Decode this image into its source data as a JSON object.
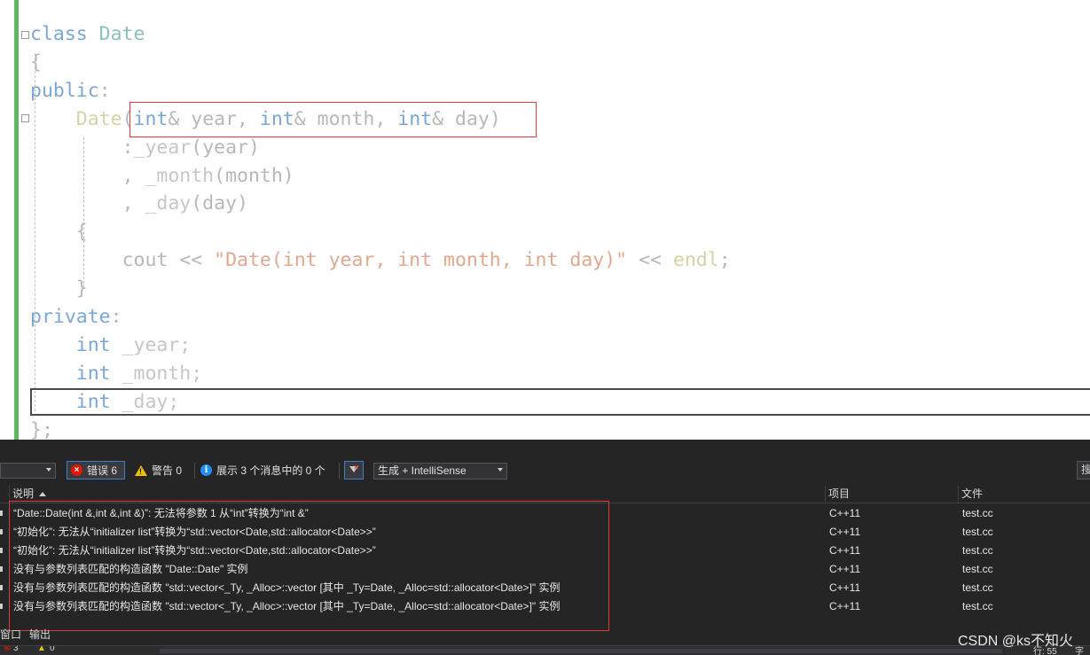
{
  "code": {
    "lines": [
      {
        "segments": [
          {
            "t": "class ",
            "c": "kw"
          },
          {
            "t": "Date",
            "c": "typ"
          }
        ]
      },
      {
        "segments": [
          {
            "t": "{",
            "c": "plain"
          }
        ]
      },
      {
        "segments": [
          {
            "t": "public",
            "c": "kw"
          },
          {
            "t": ":",
            "c": "plain"
          }
        ]
      },
      {
        "segments": [
          {
            "t": "    "
          },
          {
            "t": "Date",
            "c": "fn"
          },
          {
            "t": "(",
            "c": "plain"
          },
          {
            "t": "int",
            "c": "kw"
          },
          {
            "t": "& year, ",
            "c": "plain"
          },
          {
            "t": "int",
            "c": "kw"
          },
          {
            "t": "& month, ",
            "c": "plain"
          },
          {
            "t": "int",
            "c": "kw"
          },
          {
            "t": "& day)",
            "c": "plain"
          }
        ]
      },
      {
        "segments": [
          {
            "t": "        "
          },
          {
            "t": ":",
            "c": "plain"
          },
          {
            "t": "_year",
            "c": "mem"
          },
          {
            "t": "(year)",
            "c": "plain"
          }
        ]
      },
      {
        "segments": [
          {
            "t": "        "
          },
          {
            "t": ", ",
            "c": "plain"
          },
          {
            "t": "_month",
            "c": "mem"
          },
          {
            "t": "(month)",
            "c": "plain"
          }
        ]
      },
      {
        "segments": [
          {
            "t": "        "
          },
          {
            "t": ", ",
            "c": "plain"
          },
          {
            "t": "_day",
            "c": "mem"
          },
          {
            "t": "(day)",
            "c": "plain"
          }
        ]
      },
      {
        "segments": [
          {
            "t": "    "
          },
          {
            "t": "{",
            "c": "plain"
          }
        ]
      },
      {
        "segments": [
          {
            "t": "        "
          },
          {
            "t": "cout << ",
            "c": "plain"
          },
          {
            "t": "\"Date(int year, int month, int day)\"",
            "c": "str"
          },
          {
            "t": " << ",
            "c": "plain"
          },
          {
            "t": "endl",
            "c": "fn"
          },
          {
            "t": ";",
            "c": "plain"
          }
        ]
      },
      {
        "segments": [
          {
            "t": "    "
          },
          {
            "t": "}",
            "c": "plain"
          }
        ]
      },
      {
        "segments": [
          {
            "t": "private",
            "c": "kw"
          },
          {
            "t": ":",
            "c": "plain"
          }
        ]
      },
      {
        "segments": [
          {
            "t": "    "
          },
          {
            "t": "int",
            "c": "kw"
          },
          {
            "t": " _year;",
            "c": "mem"
          }
        ]
      },
      {
        "segments": [
          {
            "t": "    "
          },
          {
            "t": "int",
            "c": "kw"
          },
          {
            "t": " _month;",
            "c": "mem"
          }
        ]
      },
      {
        "segments": [
          {
            "t": "    "
          },
          {
            "t": "int",
            "c": "kw"
          },
          {
            "t": " _day;",
            "c": "mem"
          }
        ]
      },
      {
        "segments": [
          {
            "t": "};",
            "c": "plain"
          }
        ]
      }
    ]
  },
  "colors": {
    "keyword": "#7ba7d6",
    "type": "#8cc2b4",
    "function": "#d8d1a6",
    "string": "#e0a88f",
    "gutter_bar": "#5cb85c",
    "highlight_box": "#e03a3a",
    "panel_bg": "#252526",
    "error_icon": "#e51400",
    "warning_icon": "#f0c000",
    "info_icon": "#1e90ff"
  },
  "toolbar": {
    "errors_label": "错误 6",
    "warnings_label": "警告 0",
    "messages_label": "展示 3 个消息中的 0 个",
    "source_selected": "生成 + IntelliSense",
    "search_stub": "搜"
  },
  "icons": {
    "error": "error-circle-icon",
    "warning": "warning-triangle-icon",
    "info": "info-circle-icon",
    "filter": "filter-icon"
  },
  "columns": {
    "description": "说明",
    "project": "项目",
    "file": "文件"
  },
  "errors": [
    {
      "description": "“Date::Date(int &,int &,int &)”: 无法将参数 1 从“int”转换为“int &”",
      "project": "C++11",
      "file": "test.cc"
    },
    {
      "description": "“初始化”: 无法从“initializer list”转换为“std::vector<Date,std::allocator<Date>>”",
      "project": "C++11",
      "file": "test.cc"
    },
    {
      "description": "“初始化”: 无法从“initializer list”转换为“std::vector<Date,std::allocator<Date>>”",
      "project": "C++11",
      "file": "test.cc"
    },
    {
      "description": "没有与参数列表匹配的构造函数 \"Date::Date\" 实例",
      "project": "C++11",
      "file": "test.cc"
    },
    {
      "description": "没有与参数列表匹配的构造函数 \"std::vector<_Ty, _Alloc>::vector [其中 _Ty=Date, _Alloc=std::allocator<Date>]\" 实例",
      "project": "C++11",
      "file": "test.cc"
    },
    {
      "description": "没有与参数列表匹配的构造函数 \"std::vector<_Ty, _Alloc>::vector [其中 _Ty=Date, _Alloc=std::allocator<Date>]\" 实例",
      "project": "C++11",
      "file": "test.cc"
    }
  ],
  "tabs": {
    "window": "窗口",
    "output": "输出"
  },
  "status": {
    "errors": "3",
    "warnings": "0",
    "line": "行: 55",
    "extra": "字符"
  },
  "watermark": "CSDN @ks不知火"
}
